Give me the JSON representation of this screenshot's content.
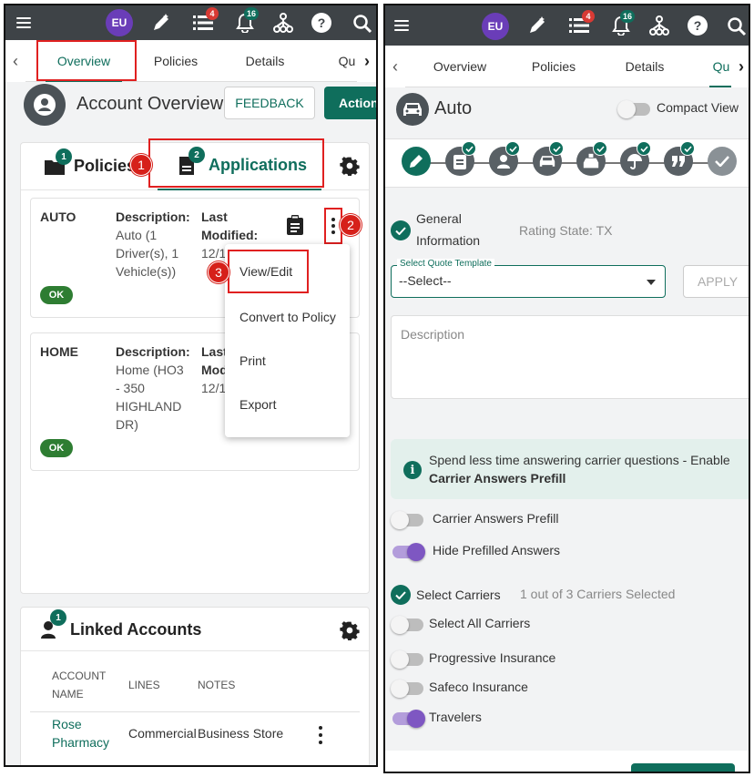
{
  "header": {
    "avatar_initials": "EU",
    "tasks_badge": "4",
    "notifications_badge": "16"
  },
  "left": {
    "tabs": [
      "Overview",
      "Policies",
      "Details",
      "Qu"
    ],
    "page_title": "Account Overview",
    "feedback_label": "FEEDBACK",
    "actions_label": "Action",
    "policies_tab": {
      "label": "Policies",
      "count": "1"
    },
    "applications_tab": {
      "label": "Applications",
      "count": "2"
    },
    "callouts": [
      "1",
      "2",
      "3"
    ],
    "applications": [
      {
        "line": "AUTO",
        "desc_label": "Description:",
        "desc": [
          "Auto (1",
          "Driver(s), 1",
          "Vehicle(s))"
        ],
        "mod_label": [
          "Last",
          "Modified:"
        ],
        "mod_value": "12/1",
        "status": "OK"
      },
      {
        "line": "HOME",
        "desc_label": "Description:",
        "desc": [
          "Home (HO3",
          "- 350",
          "HIGHLAND",
          "DR)"
        ],
        "mod_label": [
          "Last",
          "Mod"
        ],
        "mod_value": "12/1",
        "status": "OK"
      }
    ],
    "menu": [
      "View/Edit",
      "Convert to Policy",
      "Print",
      "Export"
    ],
    "linked_accounts": {
      "title": "Linked Accounts",
      "count": "1",
      "headers": [
        "ACCOUNT",
        "NAME",
        "LINES",
        "NOTES"
      ],
      "rows": [
        {
          "name": [
            "Rose",
            "Pharmacy"
          ],
          "lines": "Commercial",
          "notes": "Business Store"
        }
      ]
    }
  },
  "right": {
    "tabs": [
      "Overview",
      "Policies",
      "Details",
      "Qu"
    ],
    "title": "Auto",
    "compact_view_label": "Compact View",
    "general_info": [
      "General",
      "Information"
    ],
    "rating_state": "Rating State: TX",
    "quote_template": {
      "label": "Select Quote Template",
      "value": "--Select--"
    },
    "apply_label": "APPLY",
    "description_placeholder": "Description",
    "info_banner": {
      "text": "Spend less time answering carrier questions - Enable",
      "bold": "Carrier Answers Prefill"
    },
    "toggles": [
      {
        "label": "Carrier Answers Prefill",
        "on": false
      },
      {
        "label": "Hide Prefilled Answers",
        "on": true
      }
    ],
    "select_carriers_label": "Select Carriers",
    "carriers_selected": "1 out of 3 Carriers Selected",
    "select_all_label": "Select All Carriers",
    "carriers": [
      {
        "label": "Progressive Insurance",
        "on": false
      },
      {
        "label": "Safeco Insurance",
        "on": false
      },
      {
        "label": "Travelers",
        "on": true
      }
    ]
  },
  "colors": {
    "accent": "#0f6e5c",
    "topbar": "#3e4347",
    "callout": "#d6201a",
    "toggle_on": "#7e57c2"
  }
}
